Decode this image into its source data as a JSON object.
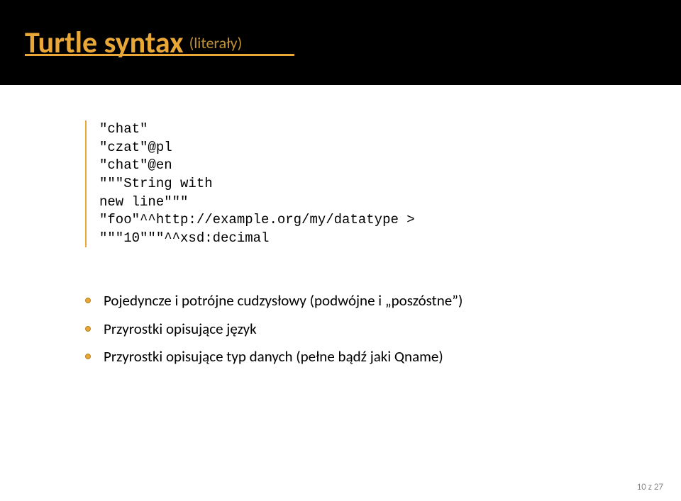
{
  "header": {
    "title_main": "Turtle syntax",
    "title_sub": "(literały)"
  },
  "code": {
    "line1": "\"chat\"",
    "line2": "\"czat\"@pl",
    "line3": "\"chat\"@en",
    "line4": "\"\"\"String with",
    "line5": "new line\"\"\"",
    "line6": "\"foo\"^^http://example.org/my/datatype >",
    "line7": "\"\"\"10\"\"\"^^xsd:decimal"
  },
  "bullets": [
    "Pojedyncze i potrójne cudzysłowy (podwójne i „poszóstne”)",
    "Przyrostki opisujące język",
    "Przyrostki opisujące typ danych (pełne bądź jaki Qname)"
  ],
  "footer": {
    "page": "10 z 27"
  }
}
